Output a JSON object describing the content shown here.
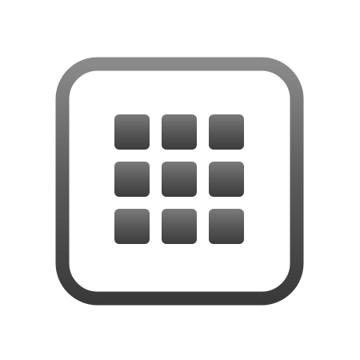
{
  "icon": {
    "name": "app-grid-icon",
    "grid_rows": 3,
    "grid_cols": 3,
    "colors": {
      "frame": "#5a5a5a",
      "frame_highlight": "#8a8a8a",
      "frame_shadow": "#3a3a3a",
      "tile": "#555555",
      "tile_highlight": "#7a7a7a",
      "tile_shadow": "#3c3c3c",
      "background": "#ffffff"
    }
  }
}
